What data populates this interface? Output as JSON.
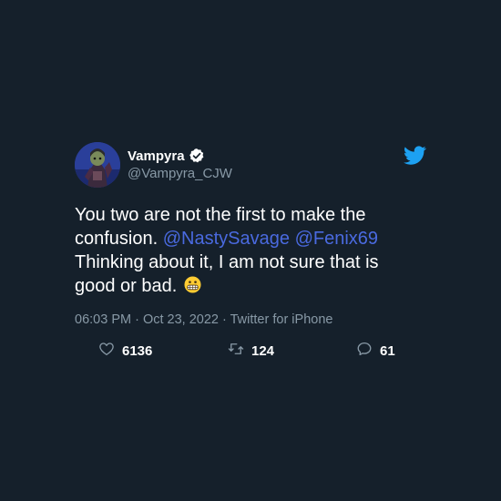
{
  "user": {
    "display_name": "Vampyra",
    "handle": "@Vampyra_CJW"
  },
  "tweet": {
    "line1": "You two are not the first to make the",
    "line2_prefix": "confusion. ",
    "mention1": "@NastySavage",
    "mention2": "@Fenix69",
    "line3": "Thinking about it, I am not sure that is",
    "line4": "good or bad."
  },
  "meta": {
    "time": "06:03 PM",
    "date": "Oct 23, 2022",
    "source": "Twitter for iPhone",
    "separator": " · "
  },
  "stats": {
    "likes": "6136",
    "retweets": "124",
    "replies": "61"
  },
  "icons": {
    "like": "heart-icon",
    "retweet": "retweet-icon",
    "reply": "reply-icon",
    "brand": "twitter-bird-icon",
    "verified": "verified-badge-icon",
    "emoji": "grimacing-face-emoji"
  },
  "colors": {
    "background": "#15202b",
    "mention": "#4a6ae0",
    "twitter_blue": "#1da1f2",
    "muted": "#8899a6"
  }
}
